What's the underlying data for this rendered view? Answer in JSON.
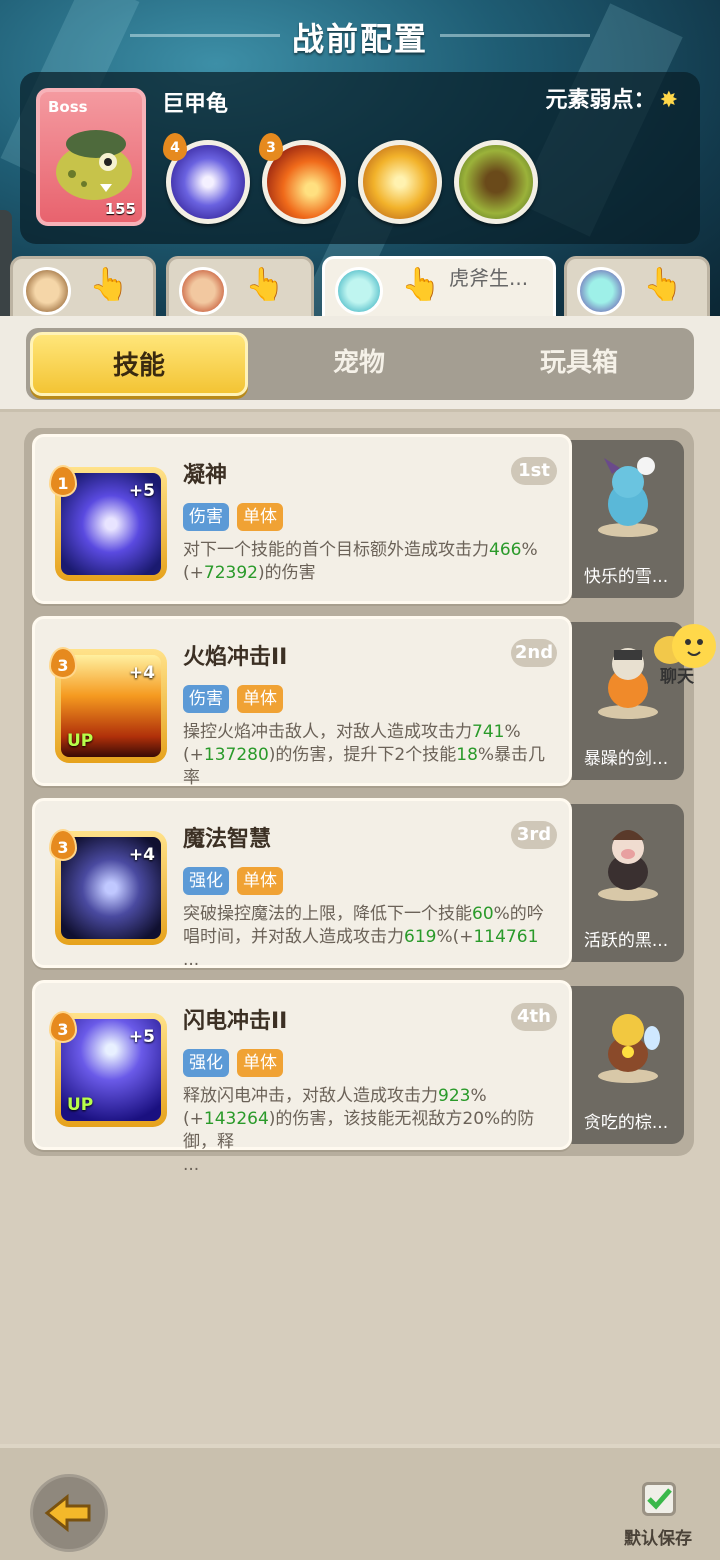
{
  "header": {
    "title": "战前配置"
  },
  "boss": {
    "badge": "Boss",
    "level": "155",
    "name": "巨甲龟",
    "weakness_label": "元素弱点：",
    "weakness_icon": "star-icon",
    "skills": [
      {
        "icon": "purple-swirl-icon",
        "level": "4"
      },
      {
        "icon": "fire-wave-icon",
        "level": "3"
      },
      {
        "icon": "golden-crown-icon",
        "level": ""
      },
      {
        "icon": "dark-shadow-icon",
        "level": ""
      }
    ]
  },
  "team_tabs": [
    {
      "name": ""
    },
    {
      "name": ""
    },
    {
      "name": "虎斧生..."
    },
    {
      "name": ""
    }
  ],
  "tabs": [
    {
      "label": "技能"
    },
    {
      "label": "宠物"
    },
    {
      "label": "玩具箱"
    }
  ],
  "skills": [
    {
      "name": "凝神",
      "rank": "1st",
      "level": "1",
      "plus": "+5",
      "up": "",
      "tags": [
        "伤害",
        "单体"
      ],
      "desc_parts": [
        "对下一个技能的首个目标额外造成攻击力",
        "466",
        "%(+",
        "72392",
        ")的伤害",
        "",
        "",
        "",
        ""
      ],
      "pet_name": "快乐的雪..."
    },
    {
      "name": "火焰冲击II",
      "rank": "2nd",
      "level": "3",
      "plus": "+4",
      "up": "UP",
      "tags": [
        "伤害",
        "单体"
      ],
      "desc_parts": [
        "操控火焰冲击敌人，对敌人造成攻击力",
        "741",
        "%(+",
        "137280",
        ")的伤害，提升下2个技能",
        "18",
        "%暴击几率",
        "",
        "..."
      ],
      "pet_name": "暴躁的剑..."
    },
    {
      "name": "魔法智慧",
      "rank": "3rd",
      "level": "3",
      "plus": "+4",
      "up": "",
      "tags": [
        "强化",
        "单体"
      ],
      "desc_parts": [
        "突破操控魔法的上限，降低下一个技能",
        "60",
        "%的吟唱时间，并对敌人造成攻击力",
        "619",
        "%(+",
        "114761",
        "",
        "",
        "..."
      ],
      "pet_name": "活跃的黑..."
    },
    {
      "name": "闪电冲击II",
      "rank": "4th",
      "level": "3",
      "plus": "+5",
      "up": "UP",
      "tags": [
        "强化",
        "单体"
      ],
      "desc_parts": [
        "释放闪电冲击，对敌人造成攻击力",
        "923",
        "%(+",
        "143264",
        ")的伤害，该技能无视敌方20%的防御，释",
        "",
        "",
        "",
        "..."
      ],
      "pet_name": "贪吃的棕..."
    }
  ],
  "chat": {
    "label": "聊天"
  },
  "footer": {
    "save_label": "默认保存"
  }
}
